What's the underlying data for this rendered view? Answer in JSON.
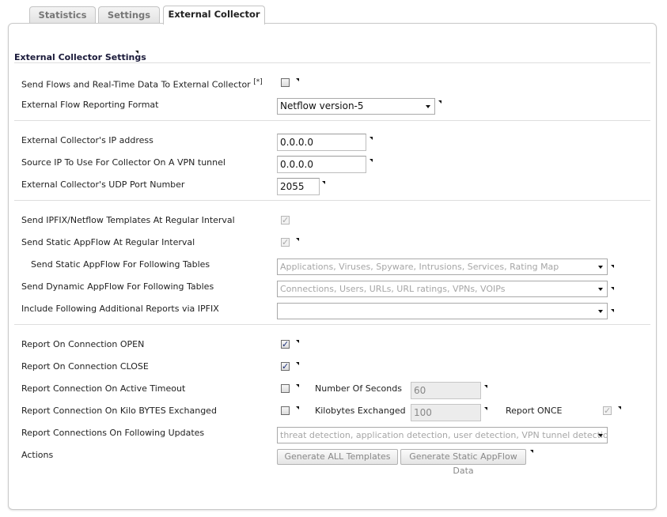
{
  "tabs": [
    {
      "label": "Statistics"
    },
    {
      "label": "Settings"
    },
    {
      "label": "External Collector"
    }
  ],
  "section_title": "External Collector Settings",
  "send_flows": {
    "label": "Send Flows and Real-Time Data To External Collector",
    "footnote": "[*]",
    "checked": false
  },
  "flow_format": {
    "label": "External Flow Reporting Format",
    "value": "Netflow version-5"
  },
  "collector_ip": {
    "label": "External Collector's IP address",
    "value": "0.0.0.0"
  },
  "source_ip": {
    "label": "Source IP To Use For Collector On A VPN tunnel",
    "value": "0.0.0.0"
  },
  "udp_port": {
    "label": "External Collector's UDP Port Number",
    "value": "2055"
  },
  "send_templates": {
    "label": "Send IPFIX/Netflow Templates At Regular Interval",
    "checked": true,
    "disabled": true
  },
  "send_static": {
    "label": "Send Static AppFlow At Regular Interval",
    "checked": true,
    "disabled": true
  },
  "static_tables": {
    "label": "Send Static AppFlow For Following Tables",
    "value": "Applications, Viruses, Spyware, Intrusions, Services, Rating Map"
  },
  "dynamic_tables": {
    "label": "Send Dynamic AppFlow For Following Tables",
    "value": "Connections, Users, URLs, URL ratings, VPNs, VOIPs"
  },
  "additional_reports": {
    "label": "Include Following Additional Reports via IPFIX",
    "value": ""
  },
  "report_open": {
    "label": "Report On Connection OPEN",
    "checked": true
  },
  "report_close": {
    "label": "Report On Connection CLOSE",
    "checked": true
  },
  "active_timeout": {
    "label": "Report Connection On Active Timeout",
    "checked": false,
    "seconds_label": "Number Of Seconds",
    "seconds_value": "60"
  },
  "kilobytes": {
    "label": "Report Connection On Kilo BYTES Exchanged",
    "checked": false,
    "kb_label": "Kilobytes Exchanged",
    "kb_value": "100",
    "once_label": "Report ONCE",
    "once_checked": true
  },
  "following_updates": {
    "label": "Report Connections On Following Updates",
    "value": "threat detection, application detection, user detection, VPN tunnel detection"
  },
  "actions": {
    "label": "Actions",
    "generate_templates": "Generate ALL Templates",
    "generate_static": "Generate Static AppFlow Data"
  },
  "check_glyph": "✓"
}
